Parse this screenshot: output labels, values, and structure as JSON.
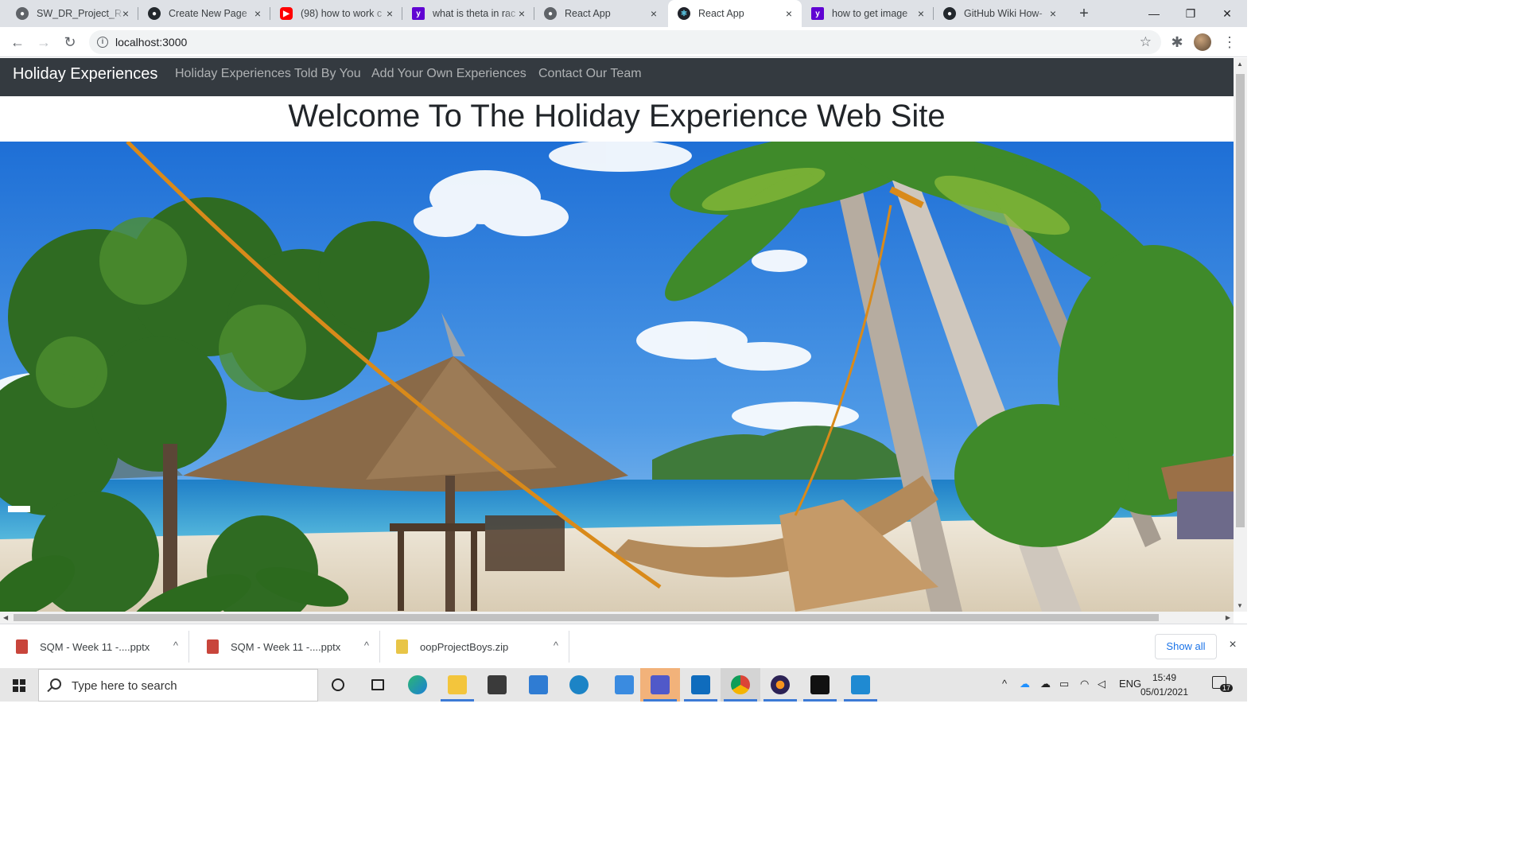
{
  "browser": {
    "tabs": [
      {
        "title": "SW_DR_Project_R",
        "icon": "globe-icon"
      },
      {
        "title": "Create New Page",
        "icon": "github-icon"
      },
      {
        "title": "(98) how to work c",
        "icon": "youtube-icon"
      },
      {
        "title": "what is theta in rac",
        "icon": "yahoo-icon"
      },
      {
        "title": "React App",
        "icon": "globe-icon"
      },
      {
        "title": "React App",
        "icon": "react-icon"
      },
      {
        "title": "how to get image",
        "icon": "yahoo-icon"
      },
      {
        "title": "GitHub Wiki How-",
        "icon": "github-icon"
      }
    ],
    "url": "localhost:3000",
    "new_tab": "+",
    "close_glyph": "×"
  },
  "app": {
    "brand": "Holiday Experiences",
    "nav": [
      "Holiday Experiences Told By You",
      "Add Your Own Experiences",
      "Contact Our Team"
    ],
    "heading": "Welcome To The Holiday Experience Web Site"
  },
  "downloads": {
    "items": [
      {
        "name": "SQM - Week 11 -....pptx",
        "type": "pdf"
      },
      {
        "name": "SQM - Week 11 -....pptx",
        "type": "pdf"
      },
      {
        "name": "oopProjectBoys.zip",
        "type": "zip"
      }
    ],
    "show_all": "Show all"
  },
  "taskbar": {
    "search_placeholder": "Type here to search",
    "language": "ENG",
    "time": "15:49",
    "date": "05/01/2021",
    "notifications": "17"
  },
  "colors": {
    "navbar": "#343a40",
    "tabstrip": "#dee1e6",
    "link_blue": "#1a73e8"
  }
}
